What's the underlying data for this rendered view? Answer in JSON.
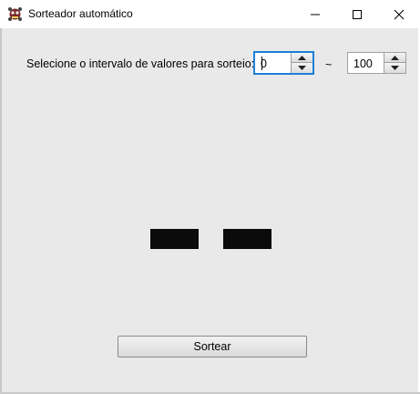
{
  "window": {
    "title": "Sorteador automático"
  },
  "form": {
    "prompt": "Selecione o intervalo de valores para sorteio:",
    "min_value": "0",
    "separator": "~",
    "max_value": "100",
    "result_boxes": [
      "",
      ""
    ],
    "draw_button": "Sortear"
  },
  "icons": [
    "app-icon",
    "minimize-icon",
    "maximize-icon",
    "close-icon",
    "arrow-up-icon",
    "arrow-down-icon"
  ]
}
